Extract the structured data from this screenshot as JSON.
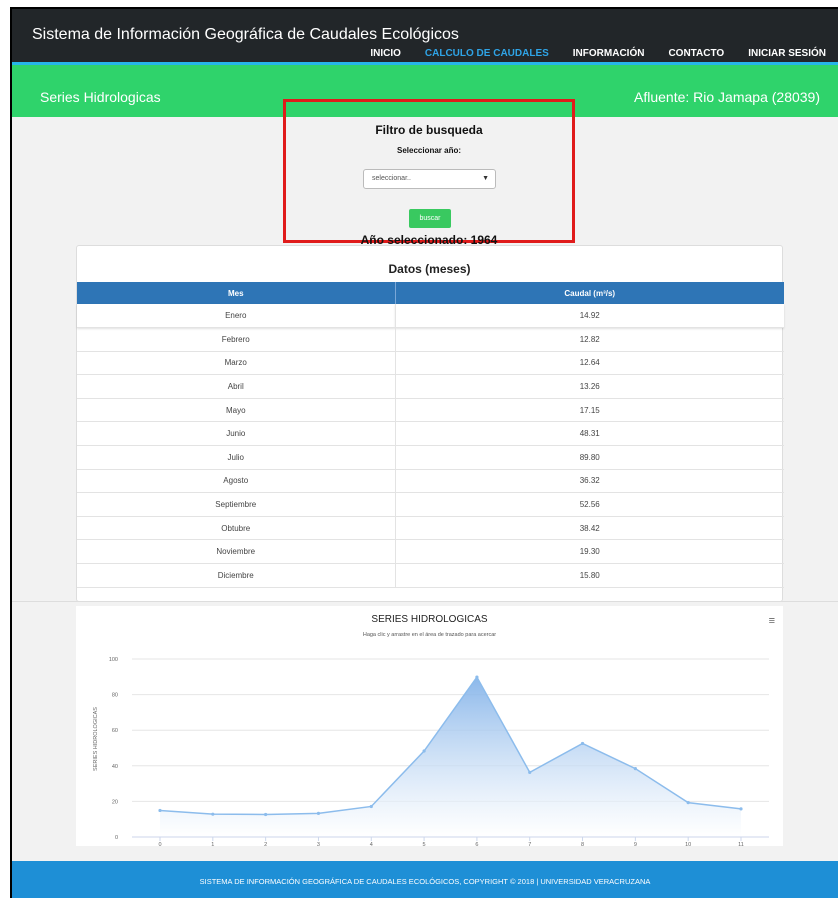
{
  "brand": "Sistema de Información Geográfica de Caudales Ecológicos",
  "nav": {
    "items": [
      "INICIO",
      "CALCULO DE CAUDALES",
      "INFORMACIÓN",
      "CONTACTO",
      "INICIAR SESIÓN"
    ],
    "active": "CALCULO DE CAUDALES"
  },
  "header": {
    "left": "Series Hidrologicas",
    "right": "Afluente: Rio Jamapa (28039)"
  },
  "filter": {
    "title": "Filtro de busqueda",
    "select_label": "Seleccionar año:",
    "select_value": "seleccionar..",
    "button_label": "buscar",
    "selected_year_text": "Año seleccionado: 1964"
  },
  "table": {
    "title": "Datos (meses)",
    "headers": [
      "Mes",
      "Caudal (m³/s)"
    ],
    "rows": [
      [
        "Enero",
        "14.92"
      ],
      [
        "Febrero",
        "12.82"
      ],
      [
        "Marzo",
        "12.64"
      ],
      [
        "Abril",
        "13.26"
      ],
      [
        "Mayo",
        "17.15"
      ],
      [
        "Junio",
        "48.31"
      ],
      [
        "Julio",
        "89.80"
      ],
      [
        "Agosto",
        "36.32"
      ],
      [
        "Septiembre",
        "52.56"
      ],
      [
        "Obtubre",
        "38.42"
      ],
      [
        "Noviembre",
        "19.30"
      ],
      [
        "Diciembre",
        "15.80"
      ]
    ]
  },
  "chart_data": {
    "type": "area",
    "title": "SERIES HIDROLOGICAS",
    "subtitle": "Haga clic y arrastre en el área de trazado para acercar",
    "ylabel": "SERIES HIDROLOGICAS",
    "xlabel": "",
    "x": [
      0,
      1,
      2,
      3,
      4,
      5,
      6,
      7,
      8,
      9,
      10,
      11
    ],
    "series": [
      {
        "values": [
          14.92,
          12.82,
          12.64,
          13.26,
          17.15,
          48.31,
          89.8,
          36.32,
          52.56,
          38.42,
          19.3,
          15.8
        ]
      }
    ],
    "xlim": [
      0,
      11
    ],
    "ylim": [
      0,
      100
    ],
    "yticks": [
      0,
      20,
      40,
      60,
      80,
      100
    ],
    "grid": true,
    "colors": {
      "line": "#8cbcec",
      "fill_top": "#7fb0e8",
      "fill_bottom": "#ffffff"
    }
  },
  "footer": "SISTEMA DE INFORMACIÓN GEOGRÁFICA DE CAUDALES ECOLÓGICOS, COPYRIGHT © 2018 | UNIVERSIDAD VERACRUZANA"
}
